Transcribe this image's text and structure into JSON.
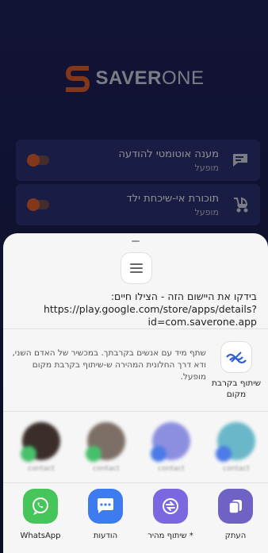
{
  "app": {
    "logo_letter": "S",
    "logo_bold": "SAVER",
    "logo_light": "ONE",
    "brand_color": "#d25a2d"
  },
  "settings": [
    {
      "title": "מענה אוטומטי להודעה",
      "status": "מופעל",
      "icon": "message-reply-icon"
    },
    {
      "title": "תוכורת אי-שיכחת ילד",
      "status": "מופעל",
      "icon": "stroller-icon"
    }
  ],
  "share_sheet": {
    "preview_icon": "document-lines-icon",
    "message": "בידקו את היישום הזה - הצילו חיים: https://play.google.com/store/apps/details?id=com.saverone.app",
    "nearby": {
      "description": "שתף מיד עם אנשים בקרבתך. במכשיר של האדם השני, ודא דרך החלונית המהירה ש-שיתוף בקרבת מקום מופעל.",
      "label": "שיתוף בקרבת מקום",
      "icon": "nearby-share-icon"
    },
    "contacts": [
      {
        "name": "contact",
        "avatar_color": "#6ab7c9",
        "badge_color": "#4a7be6"
      },
      {
        "name": "contact",
        "avatar_color": "#8c8fe0",
        "badge_color": "#4a7be6"
      },
      {
        "name": "contact",
        "avatar_color": "#7d6f66",
        "badge_color": "#47c06b"
      },
      {
        "name": "contact",
        "avatar_color": "#3b2e2a",
        "badge_color": "#47c06b"
      }
    ],
    "apps": [
      {
        "label": "העתק",
        "icon": "copy-icon",
        "color": "#6e63c5"
      },
      {
        "label": "* שיתוף מהיר",
        "icon": "quick-share-icon",
        "color": "#7b68e0"
      },
      {
        "label": "הודעות",
        "icon": "messages-icon",
        "color": "#3d7cf0"
      },
      {
        "label": "WhatsApp",
        "icon": "whatsapp-icon",
        "color": "#46c55a"
      }
    ]
  }
}
